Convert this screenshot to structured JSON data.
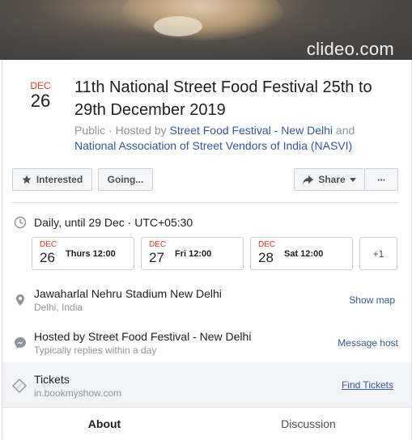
{
  "cover": {
    "watermark": "clideo.com"
  },
  "event": {
    "month": "DEC",
    "day": "26",
    "title": "11th National Street Food Festival 25th to 29th December 2019",
    "privacy": "Public",
    "hosted_by_prefix": " · Hosted by ",
    "host1": "Street Food Festival - New Delhi",
    "and": " and ",
    "host2": "National Association of Street Vendors of India (NASVI)"
  },
  "actions": {
    "interested": "Interested",
    "going": "Going...",
    "share": "Share",
    "more": "···"
  },
  "schedule": {
    "summary": "Daily, until 29 Dec · UTC+05:30",
    "dates": [
      {
        "month": "DEC",
        "day": "26",
        "time": "Thurs 12:00"
      },
      {
        "month": "DEC",
        "day": "27",
        "time": "Fri 12:00"
      },
      {
        "month": "DEC",
        "day": "28",
        "time": "Sat 12:00"
      }
    ],
    "more_label": "+1"
  },
  "location": {
    "name": "Jawaharlal Nehru Stadium New Delhi",
    "city": "Delhi, India",
    "action": "Show map"
  },
  "host": {
    "name": "Hosted by Street Food Festival - New Delhi",
    "reply": "Typically replies within a day",
    "action": "Message host"
  },
  "tickets": {
    "label": "Tickets",
    "site": "in.bookmyshow.com",
    "action": "Find Tickets"
  },
  "tabs": [
    {
      "label": "About"
    },
    {
      "label": "Discussion"
    }
  ]
}
